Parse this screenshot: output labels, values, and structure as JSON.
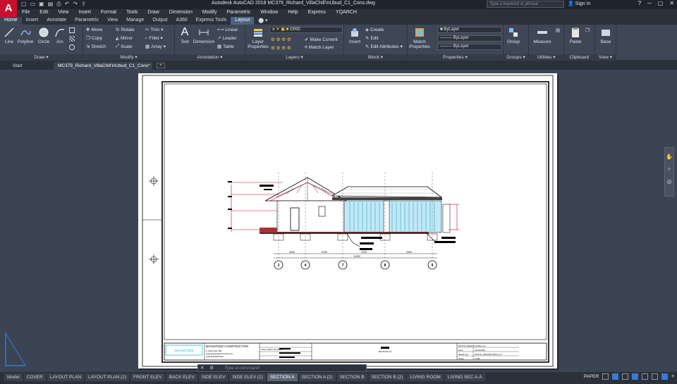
{
  "titlebar": {
    "logo": "A",
    "title": "Autodesk AutoCAD 2018    MC379_Richard_VillaChill'inUbud_C1_Cons.dwg",
    "search_placeholder": "Type a keyword or phrase",
    "signin": "Sign In"
  },
  "menubar": [
    "File",
    "Edit",
    "View",
    "Insert",
    "Format",
    "Tools",
    "Draw",
    "Dimension",
    "Modify",
    "Parametric",
    "Window",
    "Help",
    "Express",
    "YQARCH"
  ],
  "ribbon_tabs": [
    "Home",
    "Insert",
    "Annotate",
    "Parametric",
    "View",
    "Manage",
    "Output",
    "A360",
    "Express Tools",
    "Layout"
  ],
  "ribbon": {
    "draw": {
      "label": "Draw ▾",
      "line": "Line",
      "polyline": "Polyline",
      "circle": "Circle",
      "arc": "Arc"
    },
    "modify": {
      "label": "Modify ▾",
      "move": "Move",
      "rotate": "Rotate",
      "trim": "Trim",
      "copy": "Copy",
      "mirror": "Mirror",
      "fillet": "Fillet",
      "stretch": "Stretch",
      "scale": "Scale",
      "array": "Array"
    },
    "annotation": {
      "label": "Annotation ▾",
      "text": "Text",
      "dimension": "Dimension",
      "linear": "Linear",
      "leader": "Leader",
      "table": "Table"
    },
    "layers": {
      "label": "Layers ▾",
      "layer_properties": "Layer Properties",
      "layer_combo": "GRID",
      "make_current": "Make Current",
      "match_layer": "Match Layer"
    },
    "block": {
      "label": "Block ▾",
      "insert": "Insert",
      "create": "Create",
      "edit": "Edit",
      "edit_attributes": "Edit Attributes"
    },
    "properties": {
      "label": "Properties ▾",
      "match_properties": "Match Properties",
      "bylayer_1": "ByLayer",
      "bylayer_2": "ByLayer",
      "bylayer_3": "ByLayer"
    },
    "groups": {
      "label": "Groups ▾",
      "group": "Group"
    },
    "utilities": {
      "label": "Utilities ▾",
      "measure": "Measure"
    },
    "clipboard": {
      "label": "Clipboard",
      "paste": "Paste"
    },
    "view": {
      "label": "View ▾",
      "base": "Base"
    }
  },
  "filetabs": {
    "start": "Start",
    "doc": "MC379_Richard_VillaChill'inUbud_C1_Cons*"
  },
  "drawing": {
    "grid_labels": [
      "2",
      "4",
      "7",
      "8",
      "9"
    ],
    "dim_labels": [
      "3000",
      "3730",
      "3790",
      "4400"
    ],
    "total_dim": "11920",
    "company": "MAGNITUDE CONSTRUCTION",
    "company_logo": "MAGNITUDE",
    "project": "VILLA CHILL'IN UBUD",
    "sheet_title": "SECTION A-A",
    "drawing_code": "MC379_VillaChill'inUbud_C1",
    "date_label": "Date",
    "date_value": "01/11/2020",
    "sketchup_label": "Sketch Up",
    "sketchup_value": "MC379_VillaChill'inUbud_C1",
    "scale_label": "Scale",
    "scale_value": "1:100",
    "address_lines": [
      "Jl. Raya Ubud, Bali",
      "info@magnitudeconstruction.com",
      "(+62) 812-0000-0000"
    ]
  },
  "cmdline": {
    "close": "✕",
    "wrench": "⚙",
    "placeholder": "Type a command"
  },
  "layout_tabs": [
    "Model",
    "COVER",
    "LAYOUT PLAN",
    "LAYOUT PLAN (2)",
    "FRONT ELEV",
    "BACK ELEV",
    "SIDE ELEV",
    "SIDE ELEV (2)",
    "SECTION A",
    "SECTION A (2)",
    "SECTION B",
    "SECTION B (2)",
    "LIVING ROOM",
    "LIVING SEC A-A"
  ],
  "status": {
    "paper": "PAPER"
  },
  "colors": {
    "accent": "#3879d9",
    "logo": "#c8102e",
    "ribbon_bg": "#3f4756",
    "canvas_bg": "#3b4453"
  }
}
